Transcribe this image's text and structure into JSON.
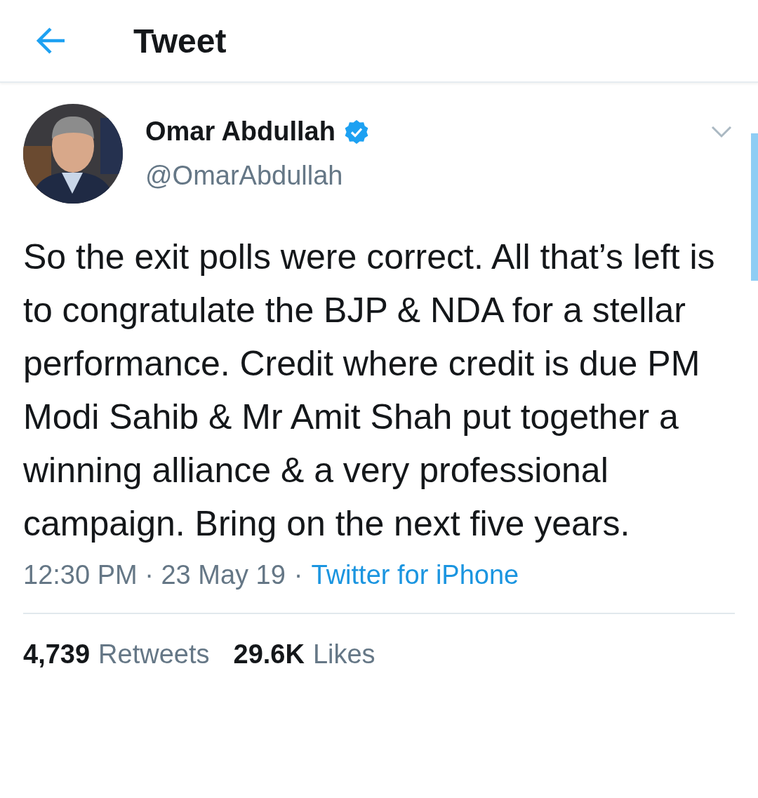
{
  "header": {
    "title": "Tweet"
  },
  "tweet": {
    "author": {
      "name": "Omar Abdullah",
      "handle": "@OmarAbdullah",
      "verified": true
    },
    "text": "So the exit polls were correct. All that’s left is to congratulate the BJP & NDA for a stellar performance. Credit where credit is due PM Modi Sahib & Mr Amit Shah put together a winning alliance & a very professional campaign. Bring on the next five years.",
    "timestamp": "12:30 PM · 23 May 19",
    "separator": "·",
    "source": "Twitter for iPhone",
    "stats": [
      {
        "count": "4,739",
        "label": "Retweets"
      },
      {
        "count": "29.6K",
        "label": "Likes"
      }
    ]
  }
}
